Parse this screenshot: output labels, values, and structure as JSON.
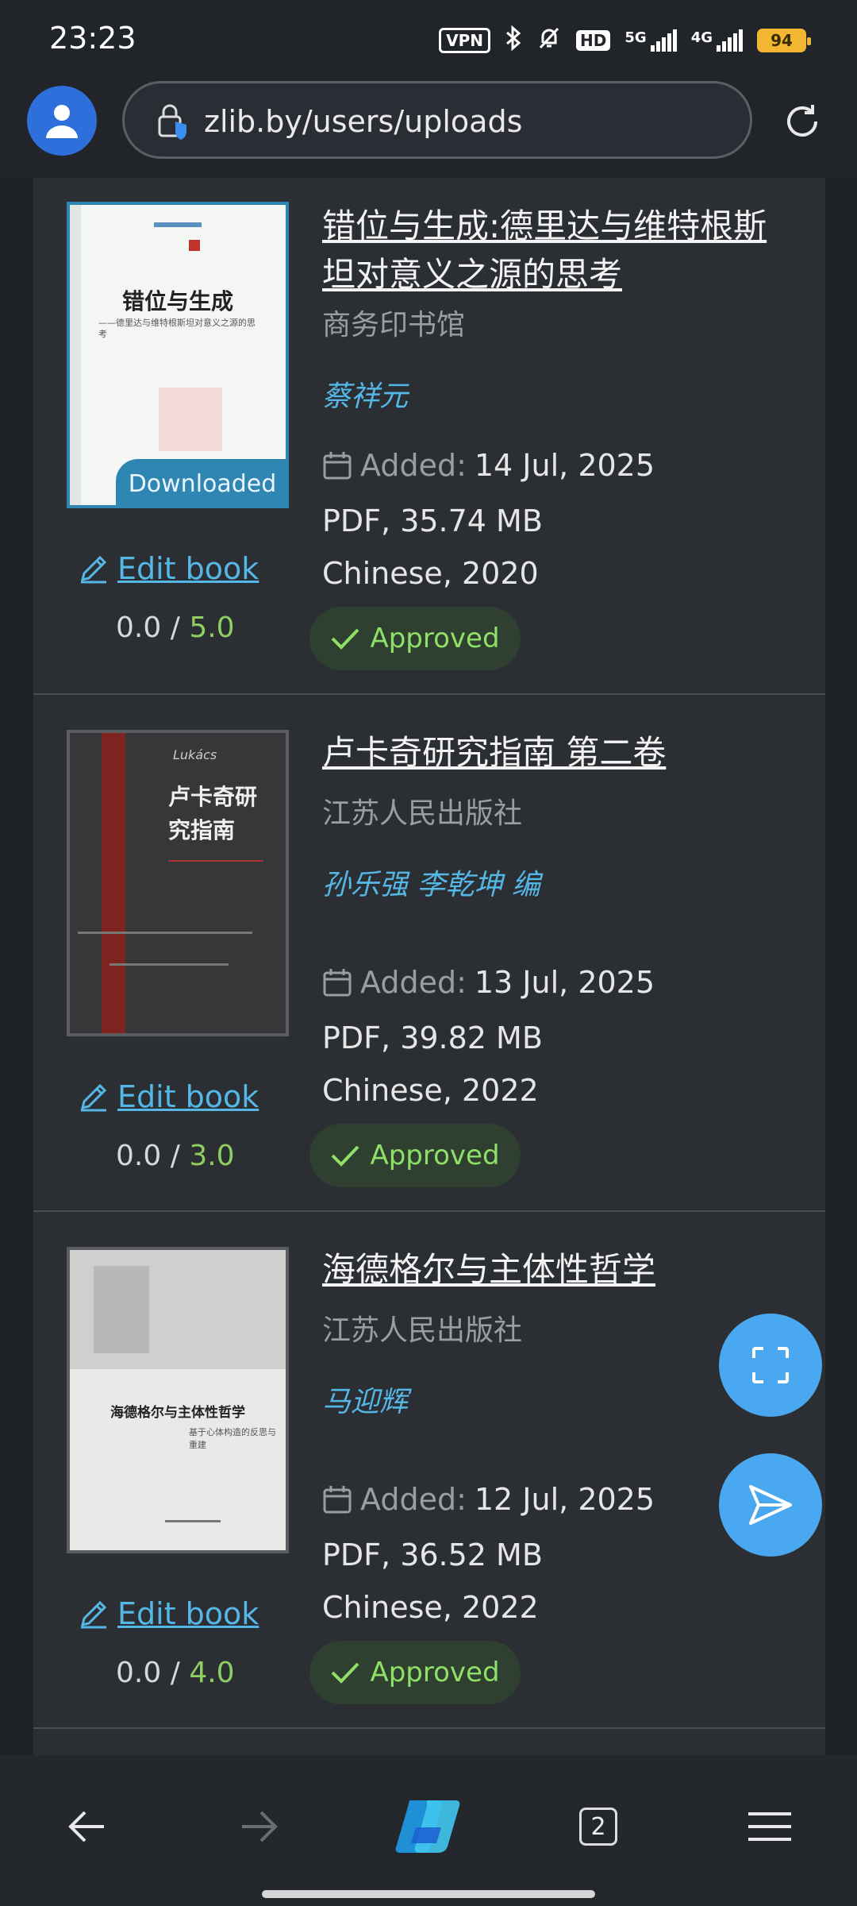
{
  "status_bar": {
    "time": "23:23",
    "vpn": "VPN",
    "hd": "HD",
    "net1": "5G",
    "net2": "4G",
    "battery": "94"
  },
  "address_bar": {
    "url": "zlib.by/users/uploads"
  },
  "common": {
    "edit_label": "Edit book",
    "added_label": "Added:",
    "approved_label": "Approved",
    "downloaded_label": "Downloaded"
  },
  "books": [
    {
      "title": "错位与生成:德里达与维特根斯坦对意义之源的思考",
      "publisher": "商务印书馆",
      "author": "蔡祥元",
      "added_date": "14 Jul, 2025",
      "format_size": "PDF, 35.74 MB",
      "lang_year": "Chinese, 2020",
      "rating": "0.0",
      "rating_sep": "/",
      "rating_max": "5.0",
      "cover_title": "错位与生成",
      "cover_sub": "——德里达与维特根斯坦对意义之源的思考"
    },
    {
      "title": "卢卡奇研究指南 第二卷",
      "publisher": "江苏人民出版社",
      "author": "孙乐强 李乾坤 编",
      "added_date": "13 Jul, 2025",
      "format_size": "PDF, 39.82 MB",
      "lang_year": "Chinese, 2022",
      "rating": "0.0",
      "rating_sep": "/",
      "rating_max": "3.0",
      "cover_title": "卢卡奇研究指南",
      "cover_sub": "Lukács"
    },
    {
      "title": "海德格尔与主体性哲学",
      "publisher": "江苏人民出版社",
      "author": "马迎辉",
      "added_date": "12 Jul, 2025",
      "format_size": "PDF, 36.52 MB",
      "lang_year": "Chinese, 2022",
      "rating": "0.0",
      "rating_sep": "/",
      "rating_max": "4.0",
      "cover_title": "海德格尔与主体性哲学",
      "cover_sub": "基于心体构造的反思与重建"
    }
  ],
  "bottom_nav": {
    "tab_count": "2"
  },
  "colors": {
    "accent_blue": "#55b7e6",
    "approved_green": "#8fe067",
    "fab_blue": "#4aa8f0"
  }
}
